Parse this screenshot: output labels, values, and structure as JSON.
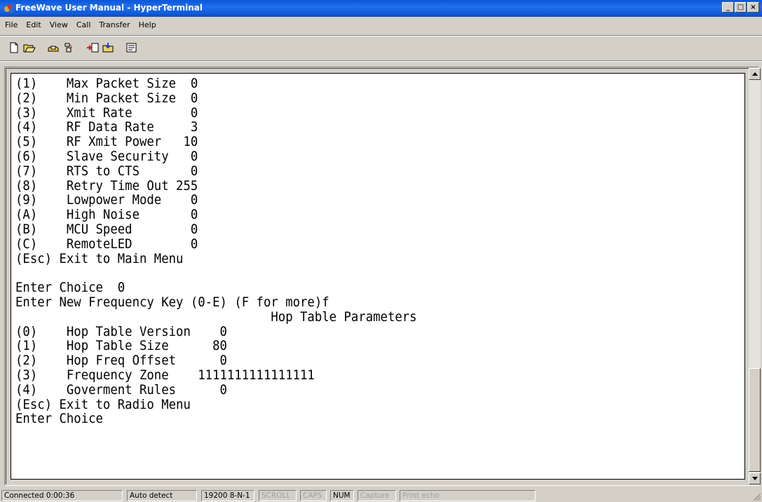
{
  "window": {
    "title": "FreeWave User Manual - HyperTerminal",
    "minimize": "_",
    "maximize": "□",
    "close": "×"
  },
  "menu": [
    "File",
    "Edit",
    "View",
    "Call",
    "Transfer",
    "Help"
  ],
  "toolbar": [
    "new-icon",
    "open-icon",
    "connect-icon",
    "disconnect-icon",
    "send-icon",
    "receive-icon",
    "properties-icon"
  ],
  "terminal": {
    "lines": [
      "(1)    Max Packet Size  0",
      "(2)    Min Packet Size  0",
      "(3)    Xmit Rate        0",
      "(4)    RF Data Rate     3",
      "(5)    RF Xmit Power   10",
      "(6)    Slave Security   0",
      "(7)    RTS to CTS       0",
      "(8)    Retry Time Out 255",
      "(9)    Lowpower Mode    0",
      "(A)    High Noise       0",
      "(B)    MCU Speed        0",
      "(C)    RemoteLED        0",
      "(Esc) Exit to Main Menu",
      "",
      "Enter Choice  0",
      "Enter New Frequency Key (0-E) (F for more)f",
      "                                   Hop Table Parameters",
      "(0)    Hop Table Version    0",
      "(1)    Hop Table Size      80",
      "(2)    Hop Freq Offset      0",
      "(3)    Frequency Zone    1111111111111111",
      "(4)    Goverment Rules      0",
      "(Esc) Exit to Radio Menu",
      "Enter Choice"
    ]
  },
  "status": {
    "connected": "Connected 0:00:36",
    "detect": "Auto detect",
    "settings": "19200 8-N-1",
    "scroll": "SCROLL",
    "caps": "CAPS",
    "num": "NUM",
    "capture": "Capture",
    "print_echo": "Print echo"
  }
}
